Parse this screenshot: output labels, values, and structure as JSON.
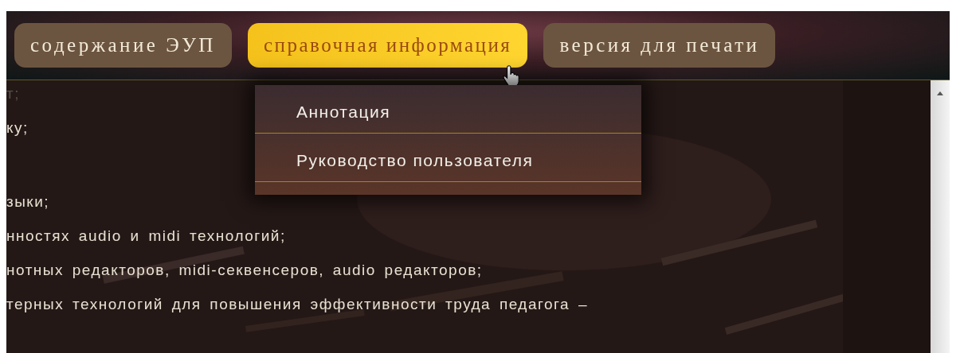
{
  "nav": [
    {
      "label": "содержание ЭУП",
      "selected": false
    },
    {
      "label": "справочная информация",
      "selected": true
    },
    {
      "label": "версия для печати",
      "selected": false
    }
  ],
  "dropdown": {
    "items": [
      "Аннотация",
      "Руководство пользователя"
    ]
  },
  "content": {
    "faded_line": "т;",
    "paragraphs": [
      [
        "ку;"
      ],
      [
        "зыки;",
        "нностях audio и midi технологий;",
        "нотных редакторов, midi-секвенсеров, audio редакторов;",
        "терных технологий для повышения эффективности труда педагога –"
      ]
    ]
  }
}
